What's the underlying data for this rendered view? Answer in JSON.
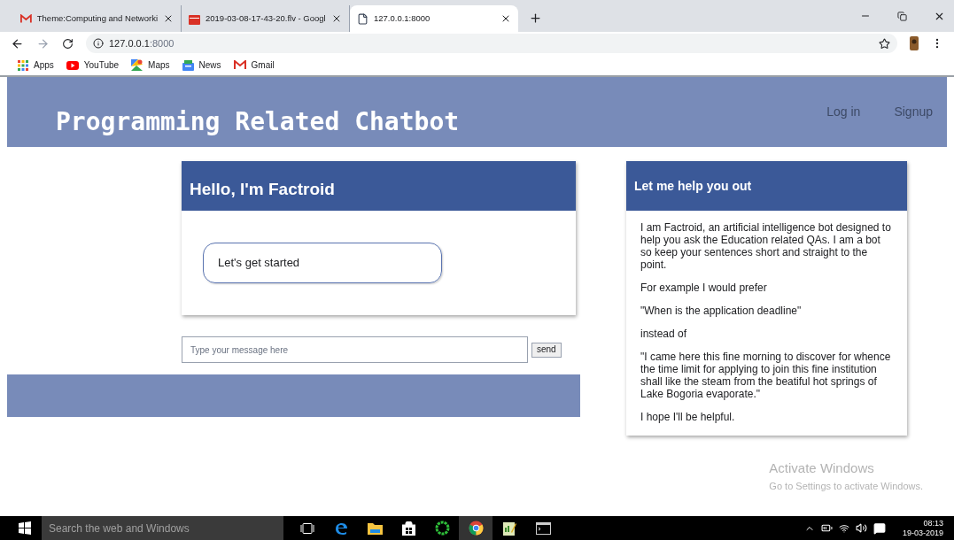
{
  "browser": {
    "tabs": [
      {
        "title": "Theme:Computing and Networki",
        "kind": "mail",
        "selected": false
      },
      {
        "title": "2019-03-08-17-43-20.flv - Googl",
        "kind": "video",
        "selected": false
      },
      {
        "title": "127.0.0.1:8000",
        "kind": "page",
        "selected": true
      }
    ],
    "url_host": "127.0.0.1",
    "url_port": ":8000",
    "bookmarks": [
      {
        "label": "Apps",
        "kind": "apps"
      },
      {
        "label": "YouTube",
        "kind": "youtube"
      },
      {
        "label": "Maps",
        "kind": "maps"
      },
      {
        "label": "News",
        "kind": "news"
      },
      {
        "label": "Gmail",
        "kind": "mail"
      }
    ]
  },
  "header": {
    "title": "Programming Related Chatbot",
    "links": [
      "Log in",
      "Signup"
    ]
  },
  "chat": {
    "title": "Hello, I'm Factroid",
    "messages": [
      "Let's get started"
    ],
    "input_placeholder": "Type your message here",
    "send_label": "send"
  },
  "help": {
    "title": "Let me help you out",
    "paragraphs": [
      "I am Factroid, an artificial intelligence bot designed to help you ask the Education related QAs. I am a bot so keep your sentences short and straight to the point.",
      "For example I would prefer",
      "\"When is the application deadline\"",
      "instead of",
      "\"I came here this fine morning to discover for whence the time limit for applying to join this fine institution shall like the steam from the beatiful hot springs of Lake Bogoria evaporate.\"",
      "I hope I'll be helpful."
    ]
  },
  "activation": {
    "title": "Activate Windows",
    "subtitle": "Go to Settings to activate Windows."
  },
  "taskbar": {
    "search_placeholder": "Search the web and Windows",
    "time": "08:13",
    "date": "19-03-2019"
  }
}
